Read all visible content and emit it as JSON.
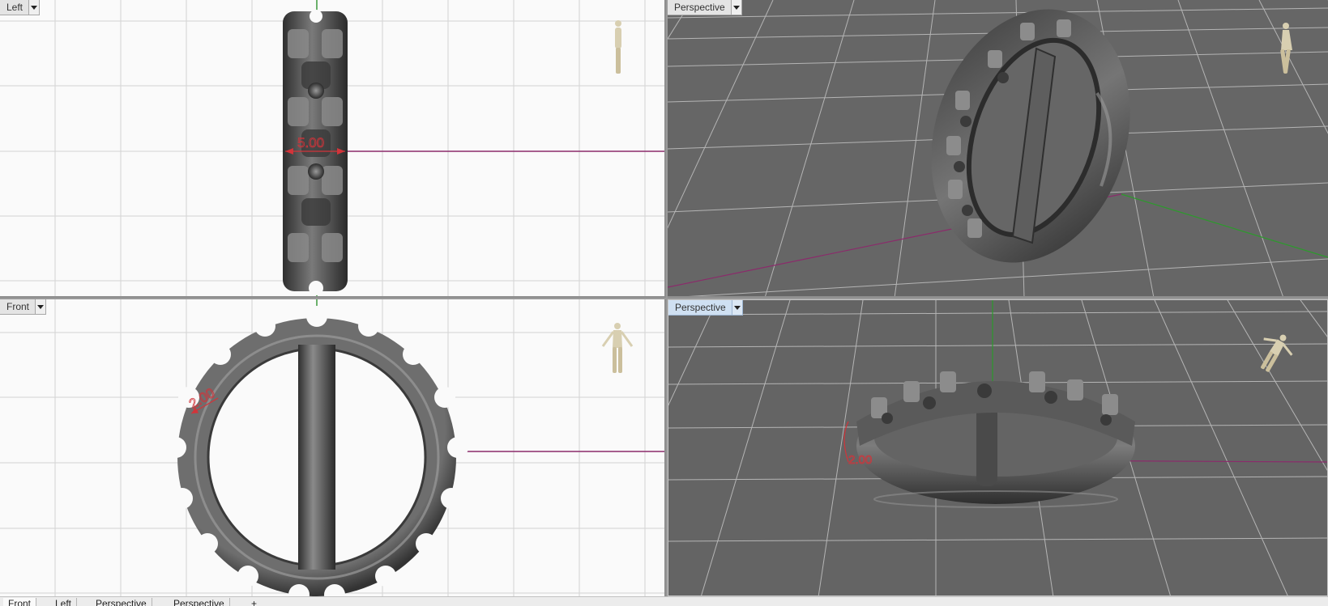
{
  "viewports": {
    "left": {
      "label": "Left",
      "dimension": "5.00"
    },
    "perspective_top": {
      "label": "Perspective"
    },
    "front": {
      "label": "Front",
      "dimension": "2.00"
    },
    "perspective_bottom": {
      "label": "Perspective",
      "dimension": "2.00"
    }
  },
  "bottom_tabs": [
    {
      "label": "Front",
      "selected": true
    },
    {
      "label": "Left",
      "selected": false
    },
    {
      "label": "Perspective",
      "selected": false
    },
    {
      "label": "Perspective",
      "selected": false
    },
    {
      "label": "+",
      "selected": false
    }
  ],
  "colors": {
    "ortho_background": "#fafafa",
    "ortho_grid": "#d2d2d2",
    "perspective_background": "#666666",
    "perspective_grid": "#d0d0d0",
    "x_axis": "#8b2b6b",
    "y_axis": "#2c9a2c",
    "dimension": "#d2343a",
    "model": "#555555",
    "active_tab": "#cfe0f2"
  },
  "icons": [
    "viewport-menu-arrow-icon",
    "human-scale-figure-icon"
  ]
}
